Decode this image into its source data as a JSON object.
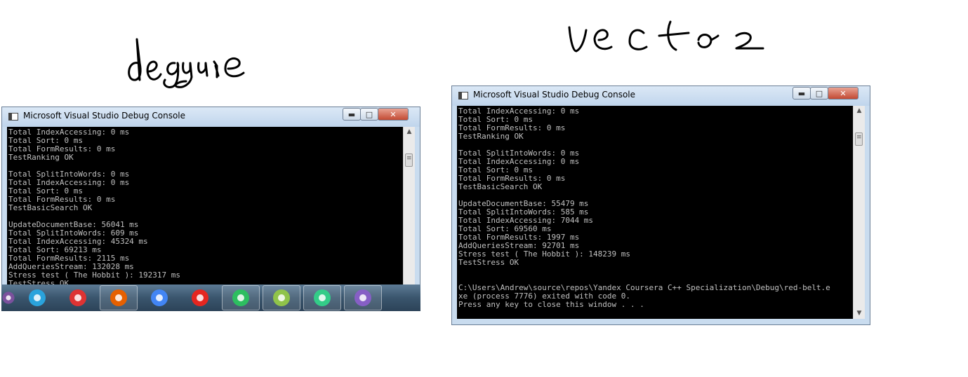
{
  "labels": {
    "left_handwritten": "deque",
    "right_handwritten": "vector"
  },
  "left_window": {
    "title": "Microsoft Visual Studio Debug Console",
    "controls": {
      "minimize": "▬",
      "maximize": "□",
      "close": "✕"
    },
    "console_text": "Total IndexAccessing: 0 ms\nTotal Sort: 0 ms\nTotal FormResults: 0 ms\nTestRanking OK\n\nTotal SplitIntoWords: 0 ms\nTotal IndexAccessing: 0 ms\nTotal Sort: 0 ms\nTotal FormResults: 0 ms\nTestBasicSearch OK\n\nUpdateDocumentBase: 56041 ms\nTotal SplitIntoWords: 609 ms\nTotal IndexAccessing: 45324 ms\nTotal Sort: 69213 ms\nTotal FormResults: 2115 ms\nAddQueriesStream: 132028 ms\nStress test ( The Hobbit ): 192317 ms\nTestStress OK"
  },
  "right_window": {
    "title": "Microsoft Visual Studio Debug Console",
    "controls": {
      "minimize": "▬",
      "maximize": "□",
      "close": "✕"
    },
    "console_text": "Total IndexAccessing: 0 ms\nTotal Sort: 0 ms\nTotal FormResults: 0 ms\nTestRanking OK\n\nTotal SplitIntoWords: 0 ms\nTotal IndexAccessing: 0 ms\nTotal Sort: 0 ms\nTotal FormResults: 0 ms\nTestBasicSearch OK\n\nUpdateDocumentBase: 55479 ms\nTotal SplitIntoWords: 585 ms\nTotal IndexAccessing: 7044 ms\nTotal Sort: 69560 ms\nTotal FormResults: 1997 ms\nAddQueriesStream: 92701 ms\nStress test ( The Hobbit ): 148239 ms\nTestStress OK\n\n\nC:\\Users\\Andrew\\source\\repos\\Yandex Coursera C++ Specialization\\Debug\\red-belt.e\nxe (process 7776) exited with code 0.\nPress any key to close this window . . ."
  },
  "taskbar": {
    "apps": [
      {
        "icon": "viber-icon",
        "color": "#7b519d"
      },
      {
        "icon": "telegram-icon",
        "color": "#2aa3dc"
      },
      {
        "icon": "tools-app-icon",
        "color": "#d33"
      },
      {
        "icon": "firefox-icon",
        "color": "#e66000"
      },
      {
        "icon": "chrome-icon",
        "color": "#4285f4"
      },
      {
        "icon": "yandex-browser-icon",
        "color": "#e52620"
      },
      {
        "icon": "evernote-icon",
        "color": "#2dbe60"
      },
      {
        "icon": "notepad-plus-plus-icon",
        "color": "#90c34a"
      },
      {
        "icon": "task-manager-icon",
        "color": "#3c8"
      },
      {
        "icon": "visual-studio-icon",
        "color": "#865fc5"
      }
    ]
  }
}
